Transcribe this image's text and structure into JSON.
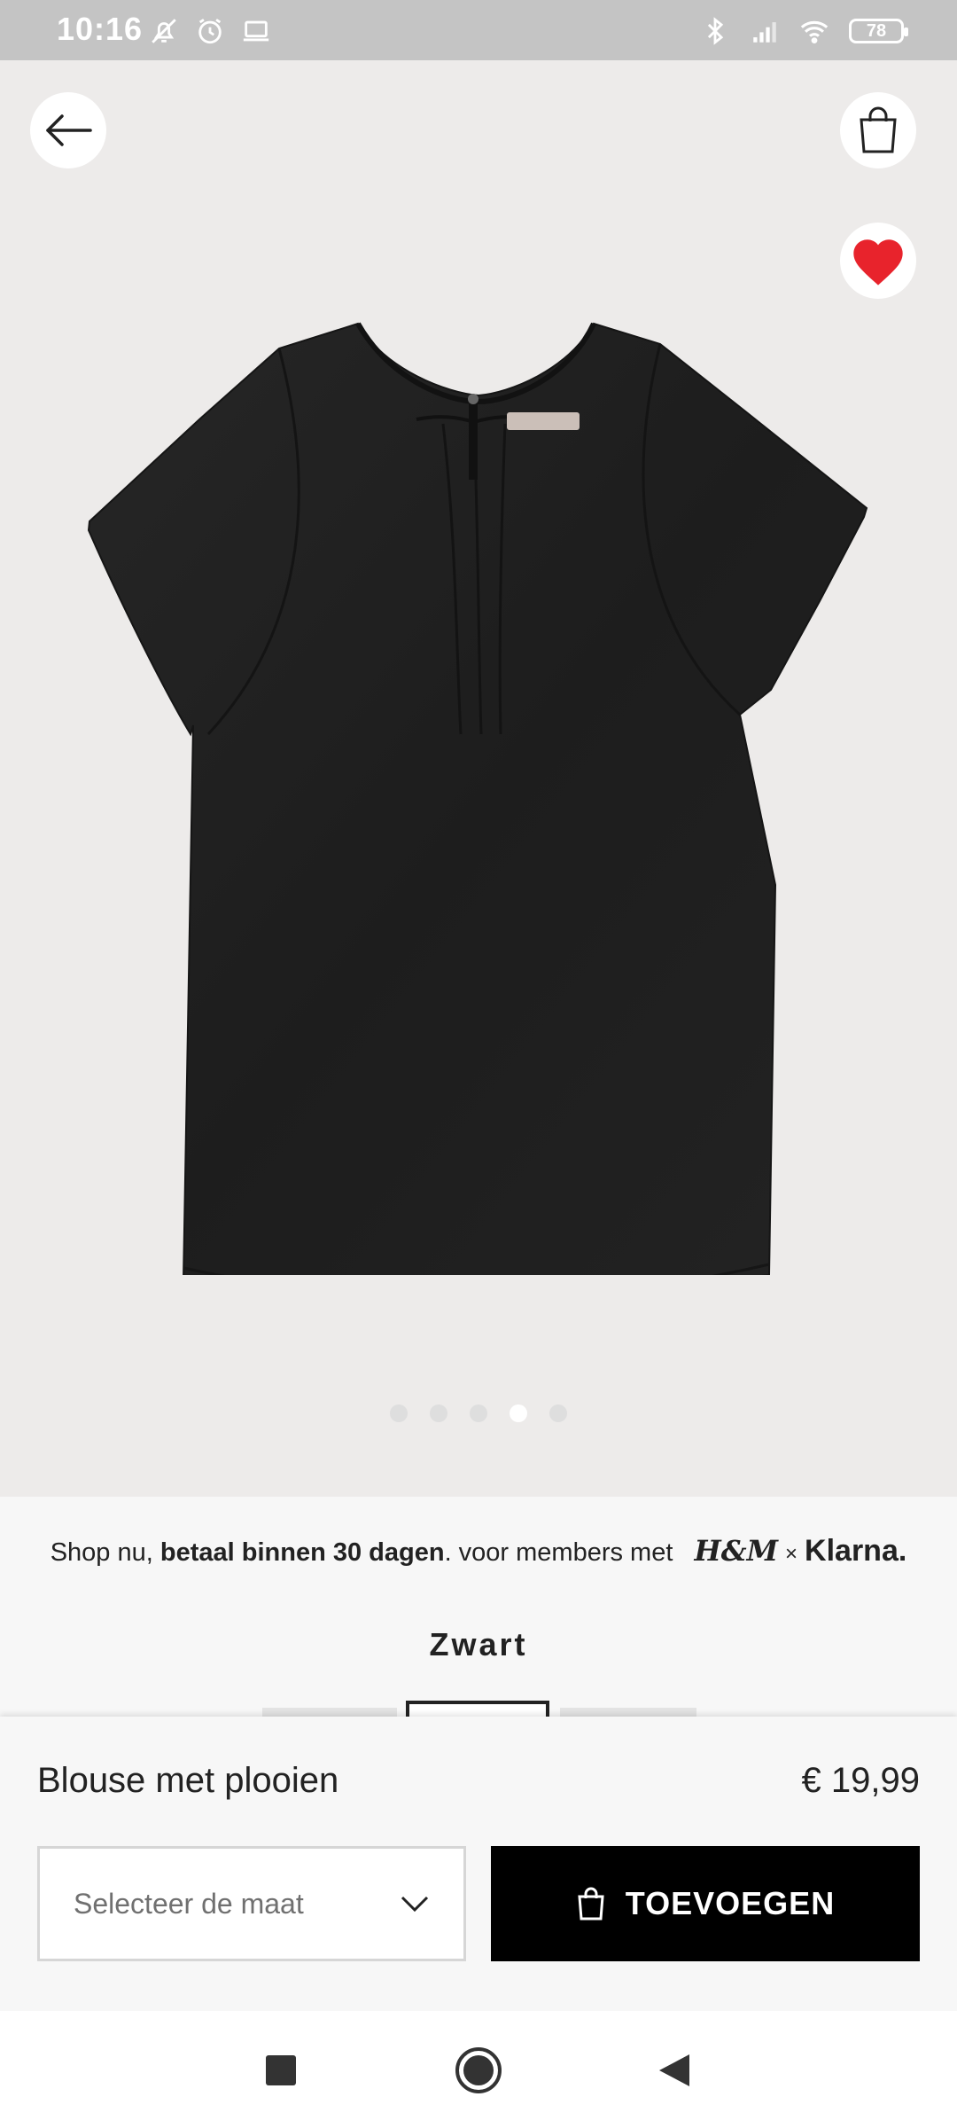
{
  "status_bar": {
    "time": "10:16",
    "battery": "78",
    "left_icons": [
      "mute-bell-icon",
      "alarm-icon",
      "laptop-icon"
    ],
    "right_icons": [
      "bluetooth-icon",
      "signal-icon",
      "wifi-icon",
      "battery-icon"
    ]
  },
  "hero": {
    "background": "#edebea",
    "carousel": {
      "count": 5,
      "active_index": 3
    },
    "heart_color": "#e8232c",
    "garment_color": "#1f1f1f"
  },
  "promo": {
    "prefix": "Shop nu,",
    "bold": "betaal binnen 30 dagen",
    "suffix": ". voor members met",
    "brand": "H&M",
    "times": "×",
    "partner": "Klarna."
  },
  "color": {
    "name": "Zwart"
  },
  "product": {
    "name": "Blouse met plooien",
    "price": "€ 19,99"
  },
  "size_select": {
    "placeholder": "Selecteer de maat"
  },
  "add_button": {
    "label": "TOEVOEGEN"
  }
}
